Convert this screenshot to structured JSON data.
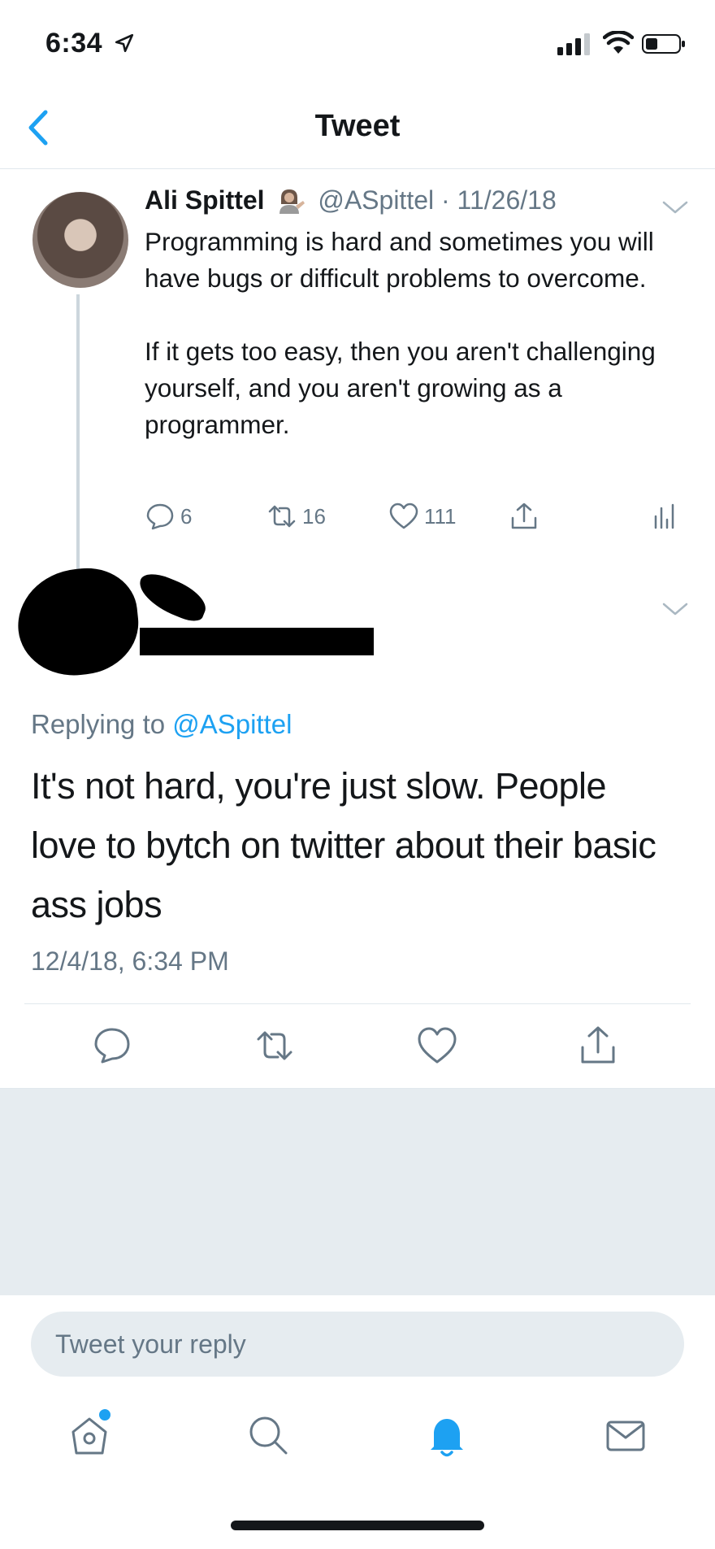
{
  "status_bar": {
    "time": "6:34"
  },
  "nav": {
    "title": "Tweet"
  },
  "original_tweet": {
    "author_name": "Ali Spittel",
    "handle_date": "@ASpittel · 11/26/18",
    "text": "Programming is hard and sometimes you will have bugs or difficult problems to overcome.\n\nIf it gets too easy, then you aren't challenging yourself, and you aren't growing as a programmer.",
    "replies": "6",
    "retweets": "16",
    "likes": "111"
  },
  "reply_tweet": {
    "replying_prefix": "Replying to ",
    "replying_handle": "@ASpittel",
    "text": "It's not hard, you're just slow. People love to bytch on twitter about their basic ass jobs",
    "timestamp": "12/4/18, 6:34 PM"
  },
  "composer": {
    "placeholder": "Tweet your reply"
  },
  "colors": {
    "accent": "#1da1f2",
    "secondary_text": "#657786",
    "background_gray": "#e6ecf0"
  },
  "icons": {
    "tabs": [
      "home-icon",
      "search-icon",
      "notifications-bell-icon",
      "messages-envelope-icon"
    ]
  }
}
